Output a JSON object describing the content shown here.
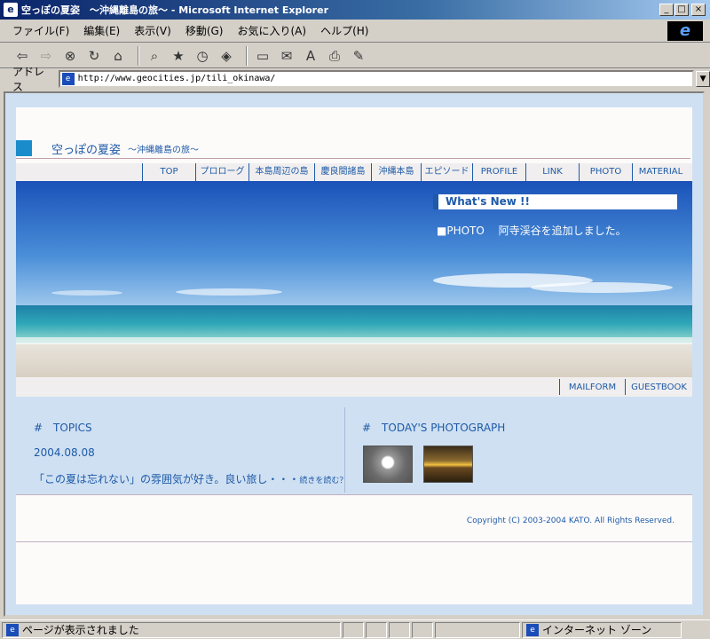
{
  "window": {
    "title": "空っぽの夏姿　〜沖縄離島の旅〜 - Microsoft Internet Explorer",
    "minimize": "_",
    "maximize": "□",
    "close": "×"
  },
  "menu": [
    "ファイル(F)",
    "編集(E)",
    "表示(V)",
    "移動(G)",
    "お気に入り(A)",
    "ヘルプ(H)"
  ],
  "toolbar": {
    "buttons": [
      "back-icon",
      "forward-icon",
      "stop-icon",
      "refresh-icon",
      "home-icon",
      "search-icon",
      "favorites-icon",
      "history-icon",
      "channels-icon",
      "fullscreen-icon",
      "mail-icon",
      "font-icon",
      "print-icon",
      "edit-icon"
    ]
  },
  "address": {
    "label": "アドレス",
    "url": "http://www.geocities.jp/tili_okinawa/"
  },
  "site": {
    "title": "空っぽの夏姿",
    "subtitle": "〜沖縄離島の旅〜",
    "nav": [
      "TOP",
      "プロローグ",
      "本島周辺の島",
      "慶良間諸島",
      "沖縄本島",
      "エピソード",
      "PROFILE",
      "LINK",
      "PHOTO",
      "MATERIAL"
    ],
    "whats_new_heading": "What's New !!",
    "whats_new_item": "■PHOTO　 阿寺渓谷を追加しました。",
    "subnav": [
      "MAILFORM",
      "GUESTBOOK"
    ],
    "topics": {
      "heading": "#　TOPICS",
      "date": "2004.08.08",
      "text": "「この夏は忘れない」の雰囲気が好き。良い旅し・・・",
      "more": "続きを読む？"
    },
    "photo": {
      "heading": "#　TODAY'S PHOTOGRAPH"
    },
    "copyright": "Copyright (C) 2003-2004 KATO. All Rights Reserved."
  },
  "status": {
    "text": "ページが表示されました",
    "zone": "インターネット ゾーン"
  },
  "colors": {
    "accent": "#1e5aa8",
    "title_square": "#1a8ccb",
    "background": "#cfe0f2"
  }
}
